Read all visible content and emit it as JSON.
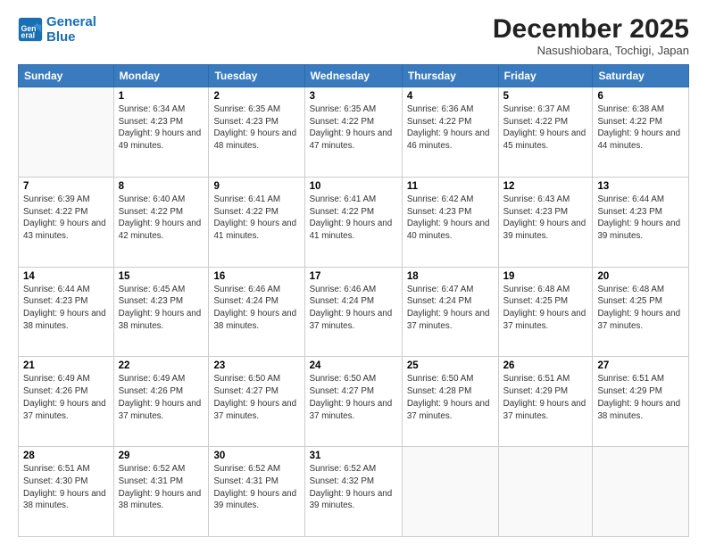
{
  "logo": {
    "line1": "General",
    "line2": "Blue"
  },
  "title": "December 2025",
  "location": "Nasushiobara, Tochigi, Japan",
  "weekdays": [
    "Sunday",
    "Monday",
    "Tuesday",
    "Wednesday",
    "Thursday",
    "Friday",
    "Saturday"
  ],
  "weeks": [
    [
      {
        "day": "",
        "sunrise": "",
        "sunset": "",
        "daylight": "",
        "empty": true
      },
      {
        "day": "1",
        "sunrise": "Sunrise: 6:34 AM",
        "sunset": "Sunset: 4:23 PM",
        "daylight": "Daylight: 9 hours and 49 minutes."
      },
      {
        "day": "2",
        "sunrise": "Sunrise: 6:35 AM",
        "sunset": "Sunset: 4:23 PM",
        "daylight": "Daylight: 9 hours and 48 minutes."
      },
      {
        "day": "3",
        "sunrise": "Sunrise: 6:35 AM",
        "sunset": "Sunset: 4:22 PM",
        "daylight": "Daylight: 9 hours and 47 minutes."
      },
      {
        "day": "4",
        "sunrise": "Sunrise: 6:36 AM",
        "sunset": "Sunset: 4:22 PM",
        "daylight": "Daylight: 9 hours and 46 minutes."
      },
      {
        "day": "5",
        "sunrise": "Sunrise: 6:37 AM",
        "sunset": "Sunset: 4:22 PM",
        "daylight": "Daylight: 9 hours and 45 minutes."
      },
      {
        "day": "6",
        "sunrise": "Sunrise: 6:38 AM",
        "sunset": "Sunset: 4:22 PM",
        "daylight": "Daylight: 9 hours and 44 minutes."
      }
    ],
    [
      {
        "day": "7",
        "sunrise": "Sunrise: 6:39 AM",
        "sunset": "Sunset: 4:22 PM",
        "daylight": "Daylight: 9 hours and 43 minutes."
      },
      {
        "day": "8",
        "sunrise": "Sunrise: 6:40 AM",
        "sunset": "Sunset: 4:22 PM",
        "daylight": "Daylight: 9 hours and 42 minutes."
      },
      {
        "day": "9",
        "sunrise": "Sunrise: 6:41 AM",
        "sunset": "Sunset: 4:22 PM",
        "daylight": "Daylight: 9 hours and 41 minutes."
      },
      {
        "day": "10",
        "sunrise": "Sunrise: 6:41 AM",
        "sunset": "Sunset: 4:22 PM",
        "daylight": "Daylight: 9 hours and 41 minutes."
      },
      {
        "day": "11",
        "sunrise": "Sunrise: 6:42 AM",
        "sunset": "Sunset: 4:23 PM",
        "daylight": "Daylight: 9 hours and 40 minutes."
      },
      {
        "day": "12",
        "sunrise": "Sunrise: 6:43 AM",
        "sunset": "Sunset: 4:23 PM",
        "daylight": "Daylight: 9 hours and 39 minutes."
      },
      {
        "day": "13",
        "sunrise": "Sunrise: 6:44 AM",
        "sunset": "Sunset: 4:23 PM",
        "daylight": "Daylight: 9 hours and 39 minutes."
      }
    ],
    [
      {
        "day": "14",
        "sunrise": "Sunrise: 6:44 AM",
        "sunset": "Sunset: 4:23 PM",
        "daylight": "Daylight: 9 hours and 38 minutes."
      },
      {
        "day": "15",
        "sunrise": "Sunrise: 6:45 AM",
        "sunset": "Sunset: 4:23 PM",
        "daylight": "Daylight: 9 hours and 38 minutes."
      },
      {
        "day": "16",
        "sunrise": "Sunrise: 6:46 AM",
        "sunset": "Sunset: 4:24 PM",
        "daylight": "Daylight: 9 hours and 38 minutes."
      },
      {
        "day": "17",
        "sunrise": "Sunrise: 6:46 AM",
        "sunset": "Sunset: 4:24 PM",
        "daylight": "Daylight: 9 hours and 37 minutes."
      },
      {
        "day": "18",
        "sunrise": "Sunrise: 6:47 AM",
        "sunset": "Sunset: 4:24 PM",
        "daylight": "Daylight: 9 hours and 37 minutes."
      },
      {
        "day": "19",
        "sunrise": "Sunrise: 6:48 AM",
        "sunset": "Sunset: 4:25 PM",
        "daylight": "Daylight: 9 hours and 37 minutes."
      },
      {
        "day": "20",
        "sunrise": "Sunrise: 6:48 AM",
        "sunset": "Sunset: 4:25 PM",
        "daylight": "Daylight: 9 hours and 37 minutes."
      }
    ],
    [
      {
        "day": "21",
        "sunrise": "Sunrise: 6:49 AM",
        "sunset": "Sunset: 4:26 PM",
        "daylight": "Daylight: 9 hours and 37 minutes."
      },
      {
        "day": "22",
        "sunrise": "Sunrise: 6:49 AM",
        "sunset": "Sunset: 4:26 PM",
        "daylight": "Daylight: 9 hours and 37 minutes."
      },
      {
        "day": "23",
        "sunrise": "Sunrise: 6:50 AM",
        "sunset": "Sunset: 4:27 PM",
        "daylight": "Daylight: 9 hours and 37 minutes."
      },
      {
        "day": "24",
        "sunrise": "Sunrise: 6:50 AM",
        "sunset": "Sunset: 4:27 PM",
        "daylight": "Daylight: 9 hours and 37 minutes."
      },
      {
        "day": "25",
        "sunrise": "Sunrise: 6:50 AM",
        "sunset": "Sunset: 4:28 PM",
        "daylight": "Daylight: 9 hours and 37 minutes."
      },
      {
        "day": "26",
        "sunrise": "Sunrise: 6:51 AM",
        "sunset": "Sunset: 4:29 PM",
        "daylight": "Daylight: 9 hours and 37 minutes."
      },
      {
        "day": "27",
        "sunrise": "Sunrise: 6:51 AM",
        "sunset": "Sunset: 4:29 PM",
        "daylight": "Daylight: 9 hours and 38 minutes."
      }
    ],
    [
      {
        "day": "28",
        "sunrise": "Sunrise: 6:51 AM",
        "sunset": "Sunset: 4:30 PM",
        "daylight": "Daylight: 9 hours and 38 minutes."
      },
      {
        "day": "29",
        "sunrise": "Sunrise: 6:52 AM",
        "sunset": "Sunset: 4:31 PM",
        "daylight": "Daylight: 9 hours and 38 minutes."
      },
      {
        "day": "30",
        "sunrise": "Sunrise: 6:52 AM",
        "sunset": "Sunset: 4:31 PM",
        "daylight": "Daylight: 9 hours and 39 minutes."
      },
      {
        "day": "31",
        "sunrise": "Sunrise: 6:52 AM",
        "sunset": "Sunset: 4:32 PM",
        "daylight": "Daylight: 9 hours and 39 minutes."
      },
      {
        "day": "",
        "sunrise": "",
        "sunset": "",
        "daylight": "",
        "empty": true
      },
      {
        "day": "",
        "sunrise": "",
        "sunset": "",
        "daylight": "",
        "empty": true
      },
      {
        "day": "",
        "sunrise": "",
        "sunset": "",
        "daylight": "",
        "empty": true
      }
    ]
  ]
}
